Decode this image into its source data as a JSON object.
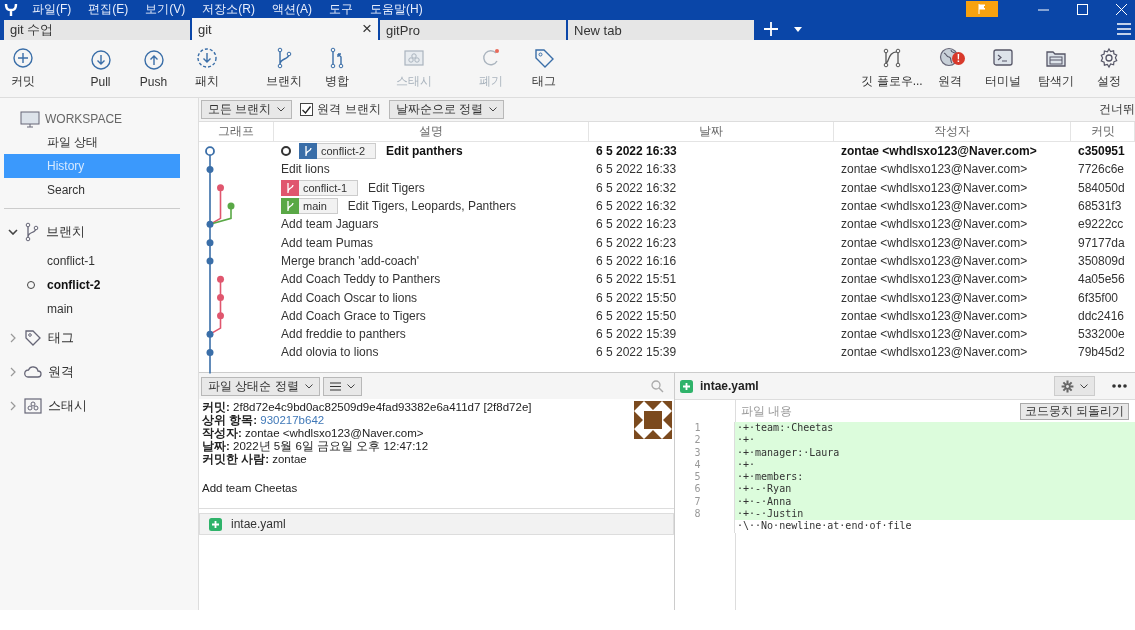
{
  "menu": [
    "파일(F)",
    "편집(E)",
    "보기(V)",
    "저장소(R)",
    "액션(A)",
    "도구",
    "도움말(H)"
  ],
  "tabs": [
    {
      "label": "git 수업",
      "selected": false
    },
    {
      "label": "git",
      "selected": true,
      "close": "×"
    },
    {
      "label": "gitPro",
      "selected": false
    },
    {
      "label": "New tab",
      "selected": false
    }
  ],
  "toolbar_left": [
    {
      "kind": "commit",
      "label": "커밋",
      "disabled": false
    },
    {
      "kind": "pull",
      "label": "Pull",
      "disabled": false
    },
    {
      "kind": "push",
      "label": "Push",
      "disabled": false
    },
    {
      "kind": "patch",
      "label": "패치",
      "disabled": false
    },
    {
      "kind": "branch",
      "label": "브랜치",
      "disabled": false
    },
    {
      "kind": "merge",
      "label": "병합",
      "disabled": false
    },
    {
      "kind": "stash",
      "label": "스태시",
      "disabled": true
    },
    {
      "kind": "discard",
      "label": "폐기",
      "disabled": true
    },
    {
      "kind": "tag",
      "label": "태그",
      "disabled": false
    }
  ],
  "toolbar_right": [
    {
      "kind": "flow",
      "label": "깃 플로우..."
    },
    {
      "kind": "remote",
      "label": "원격",
      "badge": "!"
    },
    {
      "kind": "terminal",
      "label": "터미널"
    },
    {
      "kind": "explorer",
      "label": "탐색기"
    },
    {
      "kind": "settings",
      "label": "설정"
    }
  ],
  "workspace": {
    "title": "WORKSPACE",
    "items": [
      {
        "label": "파일 상태",
        "selected": false
      },
      {
        "label": "History",
        "selected": true
      },
      {
        "label": "Search",
        "selected": false
      }
    ]
  },
  "sections": [
    {
      "kind": "branches",
      "label": "브랜치",
      "expanded": true,
      "children": [
        {
          "label": "conflict-1",
          "current": false
        },
        {
          "label": "conflict-2",
          "current": true
        },
        {
          "label": "main",
          "current": false
        }
      ]
    },
    {
      "kind": "tags",
      "label": "태그",
      "expanded": false
    },
    {
      "kind": "remotes",
      "label": "원격",
      "expanded": false
    },
    {
      "kind": "stashes",
      "label": "스태시",
      "expanded": false
    }
  ],
  "filter": {
    "branches": "모든 브랜치",
    "remote_branches": {
      "label": "원격 브랜치",
      "checked": true
    },
    "sort": "날짜순으로 정렬",
    "skip": "건너뛰"
  },
  "columns": [
    "그래프",
    "설명",
    "날짜",
    "작성자",
    "커밋"
  ],
  "rows": [
    {
      "color": "#3a6ea8",
      "current": true,
      "refs": [
        {
          "label": "conflict-2",
          "color": "#3a6ea8"
        }
      ],
      "description": "Edit panthers",
      "date": "6 5 2022 16:33",
      "author": "zontae <whdlsxo123@Naver.com>",
      "commit": "c350951"
    },
    {
      "color": "#3a6ea8",
      "current": false,
      "description": "Edit lions",
      "date": "6 5 2022 16:33",
      "author": "zontae <whdlsxo123@Naver.com>",
      "commit": "7726c6e"
    },
    {
      "color": "#e0566e",
      "current": false,
      "refs": [
        {
          "label": "conflict-1",
          "color": "#e0566e"
        }
      ],
      "description": "Edit Tigers",
      "date": "6 5 2022 16:32",
      "author": "zontae <whdlsxo123@Naver.com>",
      "commit": "584050d"
    },
    {
      "color": "#5aa846",
      "current": false,
      "refs": [
        {
          "label": "main",
          "color": "#5aa846"
        }
      ],
      "description": "Edit Tigers, Leopards, Panthers",
      "date": "6 5 2022 16:32",
      "author": "zontae <whdlsxo123@Naver.com>",
      "commit": "68531f3"
    },
    {
      "color": "#3a6ea8",
      "current": false,
      "description": "Add team Jaguars",
      "date": "6 5 2022 16:23",
      "author": "zontae <whdlsxo123@Naver.com>",
      "commit": "e9222cc"
    },
    {
      "color": "#3a6ea8",
      "current": false,
      "description": "Add team Pumas",
      "date": "6 5 2022 16:23",
      "author": "zontae <whdlsxo123@Naver.com>",
      "commit": "97177da"
    },
    {
      "color": "#3a6ea8",
      "current": false,
      "description": "Merge branch 'add-coach'",
      "date": "6 5 2022 16:16",
      "author": "zontae <whdlsxo123@Naver.com>",
      "commit": "350809d"
    },
    {
      "color": "#e0566e",
      "current": false,
      "description": "Add Coach Teddy to Panthers",
      "date": "6 5 2022 15:51",
      "author": "zontae <whdlsxo123@Naver.com>",
      "commit": "4a05e56"
    },
    {
      "color": "#e0566e",
      "current": false,
      "description": "Add Coach Oscar to lions",
      "date": "6 5 2022 15:50",
      "author": "zontae <whdlsxo123@Naver.com>",
      "commit": "6f35f00"
    },
    {
      "color": "#e0566e",
      "current": false,
      "description": "Add Coach Grace to Tigers",
      "date": "6 5 2022 15:50",
      "author": "zontae <whdlsxo123@Naver.com>",
      "commit": "ddc2416"
    },
    {
      "color": "#3a6ea8",
      "current": false,
      "description": "Add freddie to panthers",
      "date": "6 5 2022 15:39",
      "author": "zontae <whdlsxo123@Naver.com>",
      "commit": "533200e"
    },
    {
      "color": "#3a6ea8",
      "current": false,
      "description": "Add olovia to lions",
      "date": "6 5 2022 15:39",
      "author": "zontae <whdlsxo123@Naver.com>",
      "commit": "79b45d2"
    }
  ],
  "file_panel": {
    "sort": "파일 상태순 정렬"
  },
  "details": [
    {
      "text": "**커밋:** 2f8d72e4c9bd0ac82509d9e4fad93382e6a411d7 [2f8d72e]"
    },
    {
      "text": "**상위 항목:**",
      "link": "930217b642"
    },
    {
      "text": "**작성자:** zontae <whdlsxo123@Naver.com>"
    },
    {
      "text": "**날짜:** 2022년 5월 6일 금요일 오후 12:47:12"
    },
    {
      "text": "**커밋한 사람:** zontae"
    }
  ],
  "message": "Add team Cheetas",
  "files": [
    {
      "name": "intae.yaml",
      "kind": "added"
    }
  ],
  "diff": {
    "file": "intae.yaml",
    "kind": "added",
    "hunk": "파일 내용",
    "revert": "코드뭉치 되돌리기",
    "lines": [
      {
        "kind": "added",
        "num": "1",
        "text": "·+·team:·Cheetas"
      },
      {
        "kind": "added",
        "num": "2",
        "text": "·+·"
      },
      {
        "kind": "added",
        "num": "3",
        "text": "·+·manager:·Laura"
      },
      {
        "kind": "added",
        "num": "4",
        "text": "·+·"
      },
      {
        "kind": "added",
        "num": "5",
        "text": "·+·members:"
      },
      {
        "kind": "added",
        "num": "6",
        "text": "·+·-·Ryan"
      },
      {
        "kind": "added",
        "num": "7",
        "text": "·+·-·Anna"
      },
      {
        "kind": "added",
        "num": "8",
        "text": "·+·-·Justin"
      },
      {
        "kind": "context",
        "text": "·\\··No·newline·at·end·of·file"
      }
    ]
  }
}
